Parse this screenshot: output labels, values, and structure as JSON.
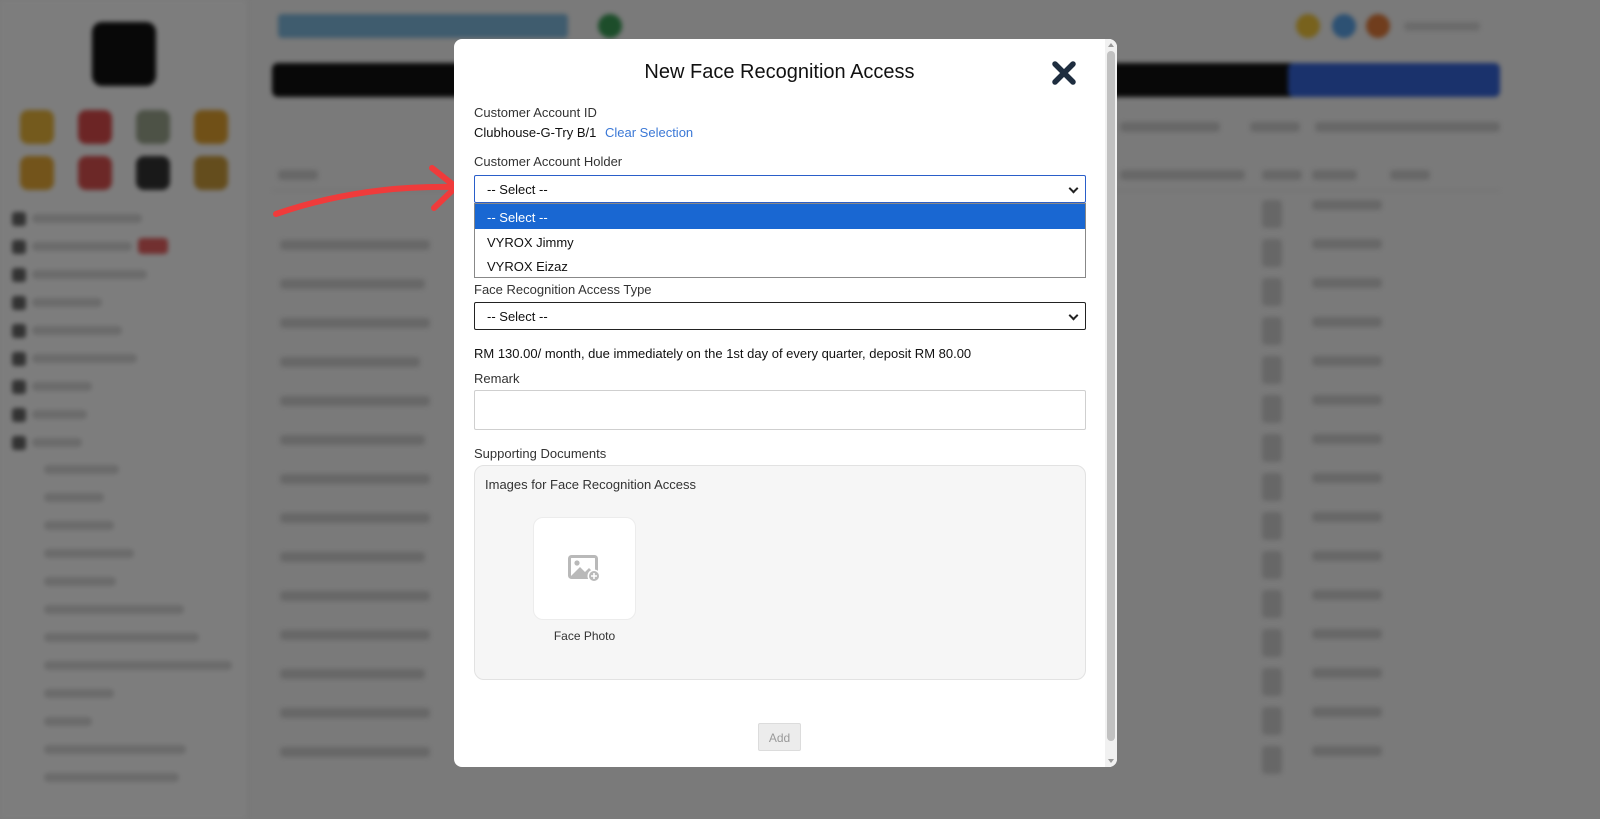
{
  "modal": {
    "title": "New Face Recognition Access",
    "customer_account_id": {
      "label": "Customer Account ID",
      "value": "Clubhouse-G-Try B/1",
      "clear_link": "Clear Selection"
    },
    "customer_account_holder": {
      "label": "Customer Account Holder",
      "selected": "-- Select --",
      "options": [
        "-- Select --",
        "VYROX Jimmy",
        "VYROX Eizaz"
      ]
    },
    "access_type": {
      "label": "Face Recognition Access Type",
      "selected": "-- Select --"
    },
    "pricing_note": "RM 130.00/ month, due immediately on the 1st day of every quarter, deposit RM 80.00",
    "remark": {
      "label": "Remark",
      "value": ""
    },
    "supporting_documents": {
      "label": "Supporting Documents",
      "section_title": "Images for Face Recognition Access",
      "photo_caption": "Face Photo"
    },
    "add_button": "Add"
  },
  "colors": {
    "accent": "#1967d2",
    "link": "#3b78d6",
    "annotation_arrow": "#ef3b3b"
  },
  "icons": {
    "close": "close-icon",
    "image_add": "image-add-icon",
    "chevron": "chevron-down-icon"
  }
}
